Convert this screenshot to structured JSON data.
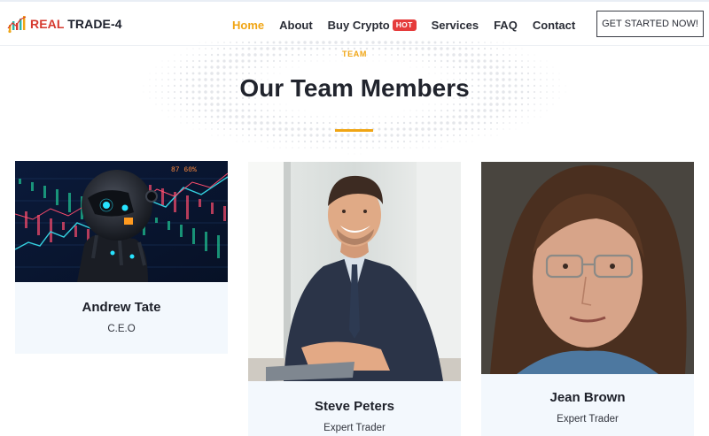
{
  "brand": {
    "name_part1": "REAL",
    "name_part2": "TRADE-4",
    "logo_icon": "bar-chart-logo-icon"
  },
  "nav": {
    "items": [
      {
        "label": "Home",
        "active": true
      },
      {
        "label": "About",
        "active": false
      },
      {
        "label": "Buy Crypto",
        "active": false,
        "badge": "HOT"
      },
      {
        "label": "Services",
        "active": false
      },
      {
        "label": "FAQ",
        "active": false
      },
      {
        "label": "Contact",
        "active": false
      }
    ],
    "cta_label": "GET STARTED NOW!"
  },
  "section": {
    "eyebrow": "TEAM",
    "title": "Our Team Members"
  },
  "team": [
    {
      "name": "Andrew Tate",
      "role": "C.E.O",
      "photo": "robot-trader-photo"
    },
    {
      "name": "Steve Peters",
      "role": "Expert Trader",
      "photo": "man-in-suit-photo"
    },
    {
      "name": "Jean Brown",
      "role": "Expert Trader",
      "photo": "woman-with-glasses-photo"
    }
  ],
  "colors": {
    "accent": "#f0a514",
    "brand_red": "#d63a2f",
    "badge_red": "#e53b3b",
    "card_bg": "#f3f8fd",
    "heading": "#21242d"
  }
}
